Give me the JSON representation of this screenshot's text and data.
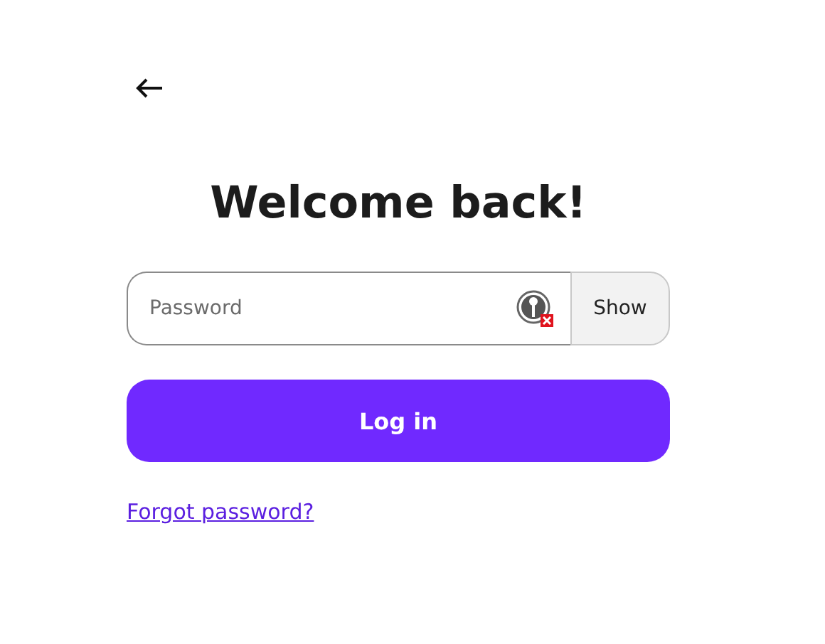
{
  "title": "Welcome back!",
  "password_field": {
    "placeholder": "Password",
    "toggle_label": "Show"
  },
  "login_button": "Log in",
  "forgot_link": "Forgot password?"
}
